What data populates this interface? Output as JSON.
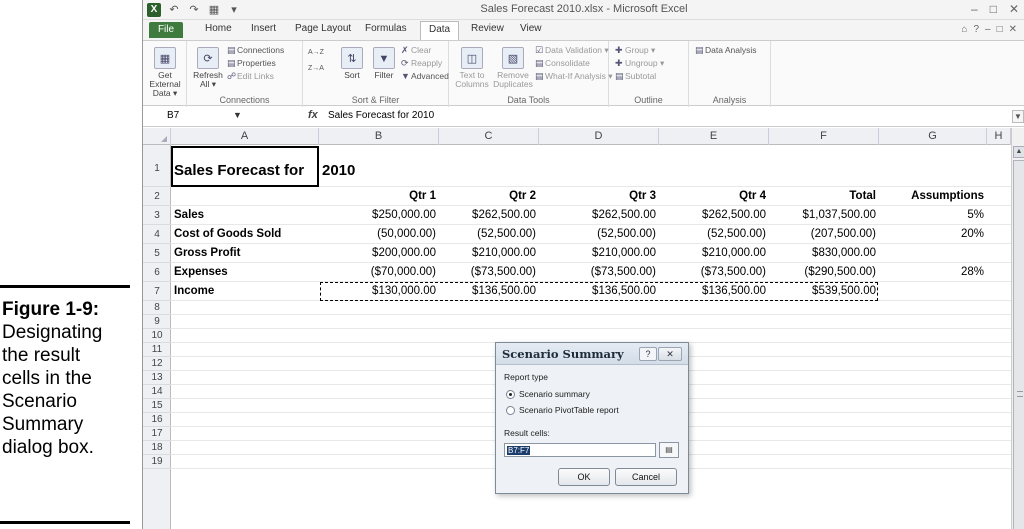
{
  "caption": {
    "figure": "Figure 1-9:",
    "lines": [
      "Designating",
      "the result",
      "cells in the",
      "Scenario",
      "Summary",
      "dialog box."
    ]
  },
  "window": {
    "title": "Sales Forecast 2010.xlsx - Microsoft Excel",
    "logo": "X",
    "qat": [
      "↶",
      "↷",
      "▦",
      "▾"
    ],
    "controls": [
      "–",
      "□",
      "✕"
    ]
  },
  "tabs": [
    "File",
    "Home",
    "Insert",
    "Page Layout",
    "Formulas",
    "Data",
    "Review",
    "View"
  ],
  "active_tab": "Data",
  "tab_icons": [
    "⌂",
    "?",
    "–",
    "□",
    "✕"
  ],
  "ribbon": {
    "get_external": "Get External Data ▾",
    "refresh": "Refresh All ▾",
    "connections": "Connections",
    "properties": "Properties",
    "edit_links": "Edit Links",
    "group_connections": "Connections",
    "sort_az": "A→Z",
    "sort_za": "Z→A",
    "sort": "Sort",
    "filter": "Filter",
    "clear": "Clear",
    "reapply": "Reapply",
    "advanced": "Advanced",
    "group_sort": "Sort & Filter",
    "text_to_columns": "Text to Columns",
    "remove_duplicates": "Remove Duplicates",
    "data_validation": "Data Validation ▾",
    "consolidate": "Consolidate",
    "what_if": "What-If Analysis ▾",
    "group_data_tools": "Data Tools",
    "group_btn": "Group ▾",
    "ungroup": "Ungroup ▾",
    "subtotal": "Subtotal",
    "group_outline": "Outline",
    "data_analysis": "Data Analysis",
    "group_analysis": "Analysis"
  },
  "formula_bar": {
    "name_box": "B7",
    "fx": "fx",
    "formula": "Sales Forecast for 2010"
  },
  "columns": [
    "A",
    "B",
    "C",
    "D",
    "E",
    "F",
    "G",
    "H"
  ],
  "rows": [
    "1",
    "2",
    "3",
    "4",
    "5",
    "6",
    "7",
    "8",
    "9",
    "10",
    "11",
    "12",
    "13",
    "14",
    "15",
    "16",
    "17",
    "18",
    "19"
  ],
  "sheet": {
    "title_a": "Sales Forecast for",
    "title_b": "2010",
    "headers": [
      "Qtr 1",
      "Qtr 2",
      "Qtr 3",
      "Qtr 4",
      "Total",
      "Assumptions"
    ],
    "rows": [
      {
        "label": "Sales",
        "values": [
          "$250,000.00",
          "$262,500.00",
          "$262,500.00",
          "$262,500.00",
          "$1,037,500.00"
        ],
        "assumption": "5%"
      },
      {
        "label": "Cost of Goods Sold",
        "values": [
          "(50,000.00)",
          "(52,500.00)",
          "(52,500.00)",
          "(52,500.00)",
          "(207,500.00)"
        ],
        "assumption": "20%"
      },
      {
        "label": "Gross Profit",
        "values": [
          "$200,000.00",
          "$210,000.00",
          "$210,000.00",
          "$210,000.00",
          "$830,000.00"
        ],
        "assumption": ""
      },
      {
        "label": "Expenses",
        "values": [
          "($70,000.00)",
          "($73,500.00)",
          "($73,500.00)",
          "($73,500.00)",
          "($290,500.00)"
        ],
        "assumption": "28%"
      },
      {
        "label": "Income",
        "values": [
          "$130,000.00",
          "$136,500.00",
          "$136,500.00",
          "$136,500.00",
          "$539,500.00"
        ],
        "assumption": ""
      }
    ]
  },
  "dialog": {
    "title": "Scenario Summary",
    "help": "?",
    "close": "✕",
    "report_type_label": "Report type",
    "option_summary": "Scenario summary",
    "option_pivot": "Scenario PivotTable report",
    "result_cells_label": "Result cells:",
    "result_cells_value": "B7:F7",
    "collapse_icon": "▤",
    "ok": "OK",
    "cancel": "Cancel"
  }
}
